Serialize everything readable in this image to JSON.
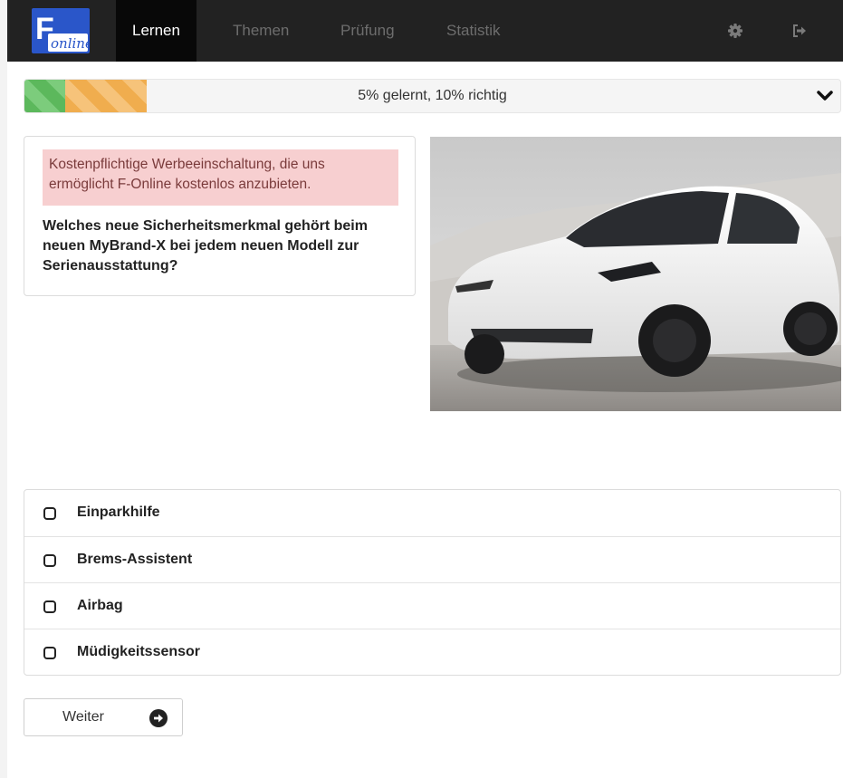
{
  "app": {
    "logo_letter": "F",
    "logo_text": "online",
    "brand_blue": "#2a56c9"
  },
  "nav": {
    "items": [
      {
        "label": "Lernen",
        "active": true
      },
      {
        "label": "Themen",
        "active": false
      },
      {
        "label": "Prüfung",
        "active": false
      },
      {
        "label": "Statistik",
        "active": false
      }
    ],
    "icons": [
      "gear-icon",
      "sign-out-icon"
    ]
  },
  "progress": {
    "text": "5% gelernt, 10% richtig",
    "learned_fraction": 0.05,
    "correct_fraction": 0.1,
    "colors": {
      "learned": "#5cb85c",
      "correct": "#f0ad4e"
    }
  },
  "question": {
    "ad_notice": "Kostenpflichtige Werbeeinschaltung, die uns ermöglicht F-Online kostenlos anzubieten.",
    "text": "Welches neue Sicherheitsmerkmal gehört beim neuen MyBrand-X bei jedem neuen Modell zur Serienausstattung?"
  },
  "answers": [
    {
      "label": "Einparkhilfe",
      "checked": false
    },
    {
      "label": "Brems-Assistent",
      "checked": false
    },
    {
      "label": "Airbag",
      "checked": false
    },
    {
      "label": "Müdigkeitssensor",
      "checked": false
    }
  ],
  "next_button": {
    "label": "Weiter"
  }
}
